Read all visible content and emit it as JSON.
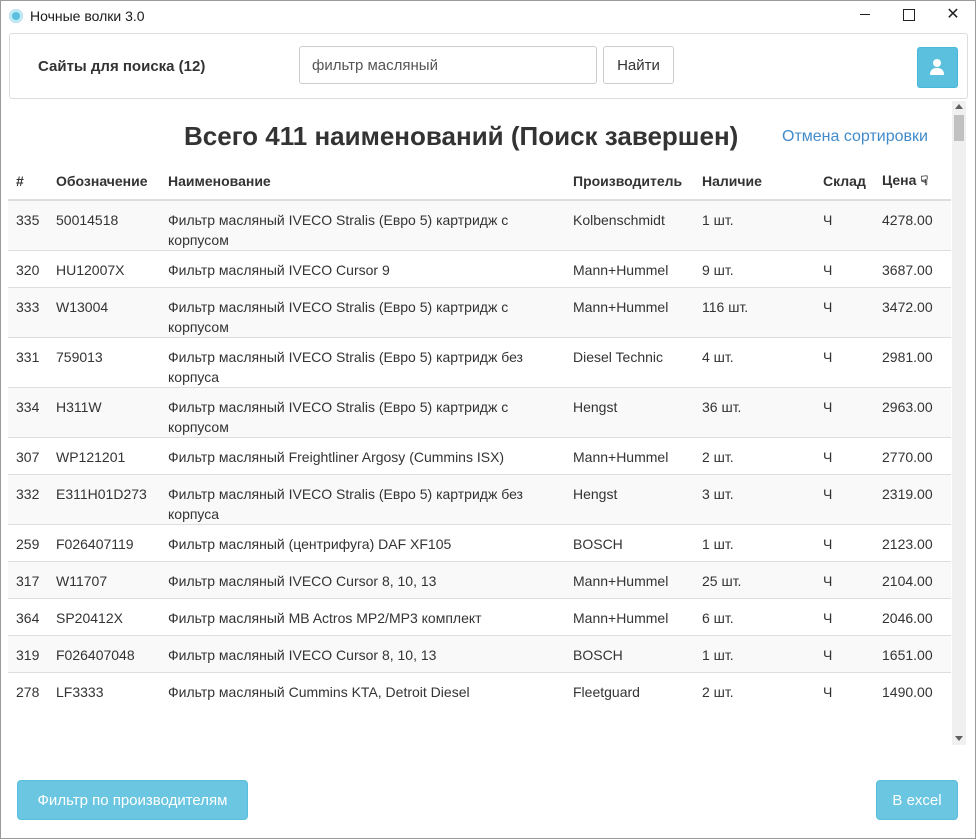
{
  "window": {
    "title": "Ночные волки 3.0"
  },
  "search": {
    "sites_label": "Сайты для поиска (12)",
    "query": "фильтр масляный",
    "find_label": "Найти"
  },
  "results": {
    "heading": "Всего 411 наименований (Поиск завершен)",
    "cancel_sort": "Отмена сортировки",
    "columns": {
      "num": "#",
      "code": "Обозначение",
      "name": "Наименование",
      "maker": "Производитель",
      "stock": "Наличие",
      "warehouse": "Склад",
      "price": "Цена",
      "price_sort_icon": "☟"
    },
    "rows": [
      {
        "num": "335",
        "code": "50014518",
        "name": "Фильтр масляный IVECO Stralis (Евро 5) картридж с корпусом",
        "maker": "Kolbenschmidt",
        "stock": "1 шт.",
        "warehouse": "Ч",
        "price": "4278.00"
      },
      {
        "num": "320",
        "code": "HU12007X",
        "name": "Фильтр масляный IVECO Cursor 9",
        "maker": "Mann+Hummel",
        "stock": "9 шт.",
        "warehouse": "Ч",
        "price": "3687.00"
      },
      {
        "num": "333",
        "code": "W13004",
        "name": "Фильтр масляный IVECO Stralis (Евро 5) картридж с корпусом",
        "maker": "Mann+Hummel",
        "stock": "116 шт.",
        "warehouse": "Ч",
        "price": "3472.00"
      },
      {
        "num": "331",
        "code": "759013",
        "name": "Фильтр масляный IVECO Stralis (Евро 5) картридж без корпуса",
        "maker": "Diesel Technic",
        "stock": "4 шт.",
        "warehouse": "Ч",
        "price": "2981.00"
      },
      {
        "num": "334",
        "code": "H311W",
        "name": "Фильтр масляный IVECO Stralis (Евро 5) картридж с корпусом",
        "maker": "Hengst",
        "stock": "36 шт.",
        "warehouse": "Ч",
        "price": "2963.00"
      },
      {
        "num": "307",
        "code": "WP121201",
        "name": "Фильтр масляный Freightliner Argosy (Cummins ISX)",
        "maker": "Mann+Hummel",
        "stock": "2 шт.",
        "warehouse": "Ч",
        "price": "2770.00"
      },
      {
        "num": "332",
        "code": "E311H01D273",
        "name": "Фильтр масляный IVECO Stralis (Евро 5) картридж без корпуса",
        "maker": "Hengst",
        "stock": "3 шт.",
        "warehouse": "Ч",
        "price": "2319.00"
      },
      {
        "num": "259",
        "code": "F026407119",
        "name": "Фильтр масляный (центрифуга) DAF XF105",
        "maker": "BOSCH",
        "stock": "1 шт.",
        "warehouse": "Ч",
        "price": "2123.00"
      },
      {
        "num": "317",
        "code": "W11707",
        "name": "Фильтр масляный IVECO Cursor 8, 10, 13",
        "maker": "Mann+Hummel",
        "stock": "25 шт.",
        "warehouse": "Ч",
        "price": "2104.00"
      },
      {
        "num": "364",
        "code": "SP20412X",
        "name": "Фильтр масляный MB Actros MP2/MP3 комплект",
        "maker": "Mann+Hummel",
        "stock": "6 шт.",
        "warehouse": "Ч",
        "price": "2046.00"
      },
      {
        "num": "319",
        "code": "F026407048",
        "name": "Фильтр масляный IVECO Cursor 8, 10, 13",
        "maker": "BOSCH",
        "stock": "1 шт.",
        "warehouse": "Ч",
        "price": "1651.00"
      },
      {
        "num": "278",
        "code": "LF3333",
        "name": "Фильтр масляный Cummins KTA, Detroit Diesel",
        "maker": "Fleetguard",
        "stock": "2 шт.",
        "warehouse": "Ч",
        "price": "1490.00"
      }
    ]
  },
  "footer": {
    "filter_label": "Фильтр по производителям",
    "excel_label": "В excel"
  },
  "colors": {
    "accent": "#5bc0de",
    "link": "#428bca"
  }
}
